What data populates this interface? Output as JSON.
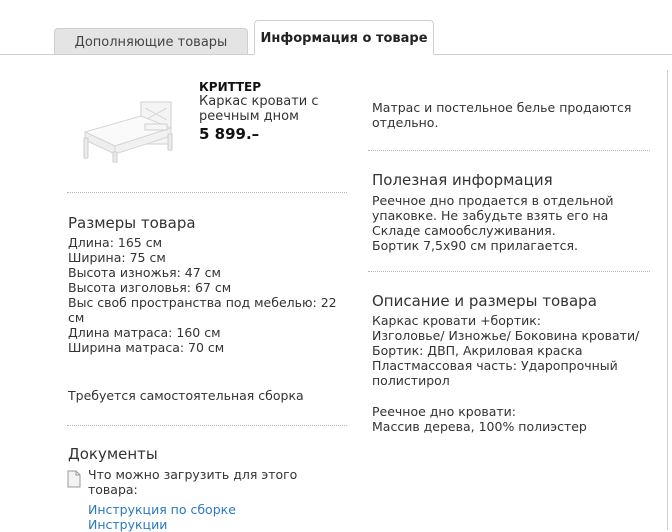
{
  "tabs": [
    {
      "label": "Дополняющие товары",
      "active": false
    },
    {
      "label": "Информация о товаре",
      "active": true
    }
  ],
  "product": {
    "name": "КРИТТЕР",
    "description": "Каркас кровати с реечным дном",
    "price": "5 899.–",
    "image_icon": "bed-frame-image"
  },
  "dimensions": {
    "heading": "Размеры товара",
    "lines": [
      "Длина: 165 см",
      "Ширина: 75 см",
      "Высота изножья: 47 см",
      "Высота изголовья: 67 см",
      "Выс своб пространства под мебелью: 22",
      "см",
      "Длина матраса: 160 см",
      "Ширина матраса: 70 см"
    ]
  },
  "assembly_note": "Требуется самостоятельная сборка",
  "documents": {
    "heading": "Документы",
    "intro_lines": [
      "Что можно загрузить для этого",
      "товара:"
    ],
    "links": [
      "Инструкция по сборке",
      "Инструкции"
    ],
    "icon": "document-icon"
  },
  "mattress_note_lines": [
    "Матрас и постельное белье продаются",
    "отдельно."
  ],
  "useful_info": {
    "heading": "Полезная информация",
    "lines": [
      "Реечное дно продается в отдельной",
      "упаковке. Не забудьте взять его на",
      "Складе самообслуживания.",
      "Бортик 7,5x90 см прилагается."
    ]
  },
  "description_section": {
    "heading": "Описание и размеры товара",
    "lines": [
      "Каркас кровати +бортик:",
      "Изголовье/ Изножье/ Боковина кровати/",
      "Бортик: ДВП, Акриловая краска",
      "Пластмассовая часть: Ударопрочный",
      "полистирол"
    ],
    "lines2": [
      "Реечное дно кровати:",
      "Массив дерева, 100% полиэстер"
    ]
  }
}
